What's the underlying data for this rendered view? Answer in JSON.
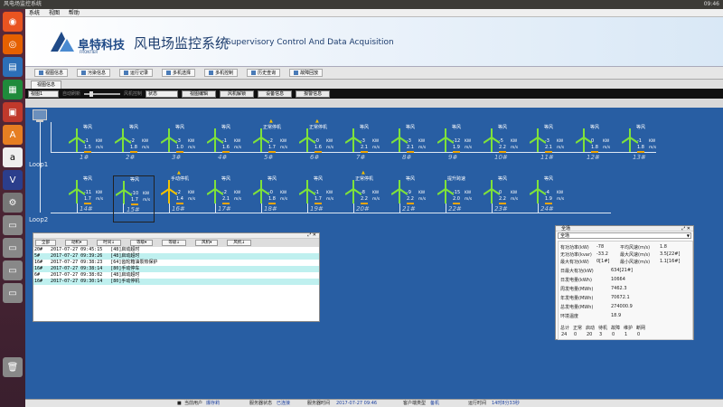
{
  "os": {
    "title": "风电场监控系统",
    "clock": "09:46"
  },
  "menu": [
    "系统",
    "视图",
    "帮助"
  ],
  "banner": {
    "brand": "阜特科技",
    "brand_sub": "FRONTIER",
    "title": "风电场监控系统",
    "subtitle": "Supervisory Control And Data Acquisition"
  },
  "toolbar": [
    "视图信息",
    "污染信息",
    "运行记录",
    "多机选择",
    "多机控制",
    "历史查询",
    "故障回放"
  ],
  "tab": "视图信息",
  "controls": {
    "view": "视图1",
    "check_label": "自动刷新",
    "slider_label": "风机控制",
    "state": "状态",
    "buttons": [
      "视图编辑",
      "风机解锁",
      "设备信息",
      "报警信息"
    ]
  },
  "loops": [
    "Loop1",
    "Loop2"
  ],
  "turbines": [
    {
      "id": "1#",
      "status": "等风",
      "power": "-1",
      "wind": "1.5",
      "yellow": false,
      "icon": false
    },
    {
      "id": "2#",
      "status": "等风",
      "power": "-2",
      "wind": "1.8",
      "yellow": false,
      "icon": false
    },
    {
      "id": "3#",
      "status": "等风",
      "power": "-3",
      "wind": "1.0",
      "yellow": false,
      "icon": false
    },
    {
      "id": "4#",
      "status": "等风",
      "power": "-1",
      "wind": "1.6",
      "yellow": false,
      "icon": false
    },
    {
      "id": "5#",
      "status": "正常停机",
      "power": "-2",
      "wind": "1.7",
      "yellow": false,
      "icon": true
    },
    {
      "id": "6#",
      "status": "正常停机",
      "power": "-0",
      "wind": "1.6",
      "yellow": false,
      "icon": true
    },
    {
      "id": "7#",
      "status": "等风",
      "power": "-3",
      "wind": "2.1",
      "yellow": false,
      "icon": false
    },
    {
      "id": "8#",
      "status": "等风",
      "power": "-3",
      "wind": "2.1",
      "yellow": false,
      "icon": false
    },
    {
      "id": "9#",
      "status": "等风",
      "power": "-12",
      "wind": "1.9",
      "yellow": false,
      "icon": false
    },
    {
      "id": "10#",
      "status": "等风",
      "power": "-5",
      "wind": "2.2",
      "yellow": false,
      "icon": false
    },
    {
      "id": "11#",
      "status": "等风",
      "power": "-3",
      "wind": "2.1",
      "yellow": false,
      "icon": false
    },
    {
      "id": "12#",
      "status": "等风",
      "power": "0",
      "wind": "1.8",
      "yellow": false,
      "icon": false
    },
    {
      "id": "13#",
      "status": "等风",
      "power": "-1",
      "wind": "1.8",
      "yellow": false,
      "icon": false
    },
    {
      "id": "14#",
      "status": "等风",
      "power": "-11",
      "wind": "1.7",
      "yellow": false,
      "icon": false
    },
    {
      "id": "15#",
      "status": "等风",
      "power": "-10",
      "wind": "1.7",
      "yellow": false,
      "icon": false
    },
    {
      "id": "16#",
      "status": "手动停机",
      "power": "-2",
      "wind": "1.4",
      "yellow": true,
      "icon": true
    },
    {
      "id": "17#",
      "status": "等风",
      "power": "-2",
      "wind": "2.1",
      "yellow": false,
      "icon": false
    },
    {
      "id": "18#",
      "status": "等风",
      "power": "-0",
      "wind": "1.8",
      "yellow": false,
      "icon": false
    },
    {
      "id": "19#",
      "status": "等风",
      "power": "-1",
      "wind": "1.7",
      "yellow": false,
      "icon": false
    },
    {
      "id": "20#",
      "status": "正常停机",
      "power": "-8",
      "wind": "2.2",
      "yellow": false,
      "icon": true
    },
    {
      "id": "21#",
      "status": "等风",
      "power": "-9",
      "wind": "2.2",
      "yellow": false,
      "icon": false
    },
    {
      "id": "22#",
      "status": "提升跨速",
      "power": "-15",
      "wind": "2.0",
      "yellow": false,
      "icon": false
    },
    {
      "id": "23#",
      "status": "等风",
      "power": "0",
      "wind": "2.2",
      "yellow": false,
      "icon": false
    },
    {
      "id": "24#",
      "status": "等风",
      "power": "-4",
      "wind": "1.9",
      "yellow": false,
      "icon": false
    }
  ],
  "units": {
    "power": "KW",
    "wind": "m/s"
  },
  "alarm": {
    "buttons": [
      "全部",
      "动机▾",
      "时间↓",
      "等级▾",
      "等级↓",
      "风机▾",
      "风机↓"
    ],
    "rows": [
      {
        "text": "20#   2017-07-27 09:45:15   [48]启动超时",
        "cls": "w"
      },
      {
        "text": "5#    2017-07-27 09:39:26   [48]启动超时",
        "cls": "c"
      },
      {
        "text": "16#   2017-07-27 09:38:23   [64]齿轮箱油泵热保护",
        "cls": "w"
      },
      {
        "text": "16#   2017-07-27 09:38:14   [80]手动停车",
        "cls": "c"
      },
      {
        "text": "6#    2017-07-27 09:38:02   [48]启动超时",
        "cls": "w"
      },
      {
        "text": "16#   2017-07-27 09:30:14   [80]手动停机",
        "cls": "c"
      }
    ]
  },
  "summary": {
    "title": "全场",
    "dropdown": "全场",
    "rows": [
      {
        "k": "有功功率(kW)",
        "v": "-78",
        "k2": "平均风速(m/s)",
        "v2": "1.8"
      },
      {
        "k": "无功功率(kvar)",
        "v": "-33.2",
        "k2": "最大风速(m/s)",
        "v2": "3.5[22#]"
      },
      {
        "k": "最大有功(kW)",
        "v": "0[1#]",
        "k2": "最小风速(m/s)",
        "v2": "1.1[16#]"
      }
    ],
    "energy": [
      {
        "k": "日最大有功(kW)",
        "v": "634[21#]"
      },
      {
        "k": "日发电量(kWh)",
        "v": "10664"
      },
      {
        "k": "周发电量(MWh)",
        "v": "7462.3"
      },
      {
        "k": "年发电量(MWh)",
        "v": "70672.1"
      },
      {
        "k": "总发电量(MWh)",
        "v": "274000.9"
      },
      {
        "k": "环境温度",
        "v": "18.9"
      }
    ],
    "count_heads": [
      "总计",
      "正常",
      "启动",
      "待机",
      "故障",
      "维护",
      "断网"
    ],
    "count_vals": [
      "24",
      "0",
      "20",
      "3",
      "0",
      "1",
      "0"
    ]
  },
  "status": {
    "user_label": "当前用户",
    "user": "爆存莉",
    "server_label": "服务器状态",
    "server": "已连接",
    "time_label": "服务器时间",
    "time": "2017-07-27 09:46",
    "client_label": "客户端类型",
    "client": "备机",
    "uptime_label": "运行时间",
    "uptime": "14时8分33秒"
  }
}
